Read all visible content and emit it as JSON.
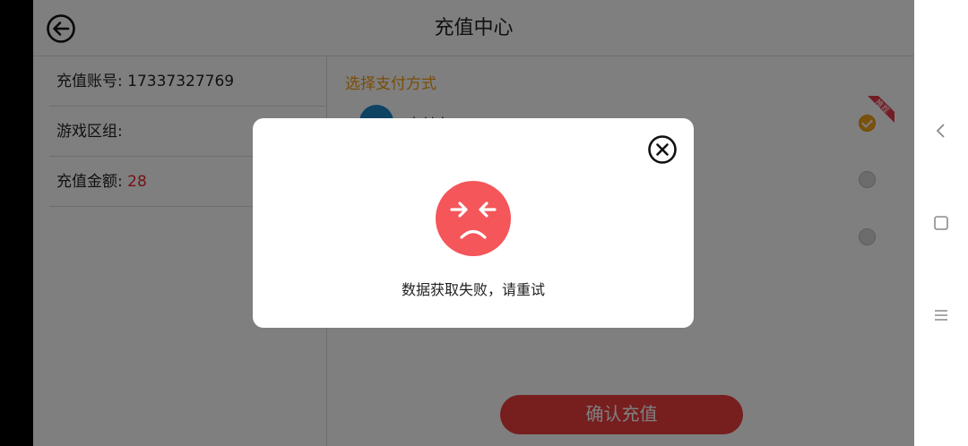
{
  "header": {
    "title": "充值中心"
  },
  "account": {
    "account_label": "充值账号:",
    "account_value": "17337327769",
    "zone_label": "游戏区组:",
    "zone_value": "",
    "amount_label": "充值金额:",
    "amount_value": "28"
  },
  "payment": {
    "section_title": "选择支付方式",
    "first_method_label": "支付宝",
    "recommend_badge": "推荐"
  },
  "confirm_button": "确认充值",
  "modal": {
    "message": "数据获取失败，请重试"
  },
  "colors": {
    "accent_orange": "#f39a10",
    "error_red": "#f4565a",
    "button_red": "#ee3d3d",
    "amount_red": "#e22233"
  },
  "icons": {
    "back": "arrow-left-circle-icon",
    "close": "close-circle-icon",
    "error": "sad-face-icon",
    "nav_back": "chevron-left-icon",
    "nav_home": "square-icon",
    "nav_menu": "menu-icon"
  }
}
